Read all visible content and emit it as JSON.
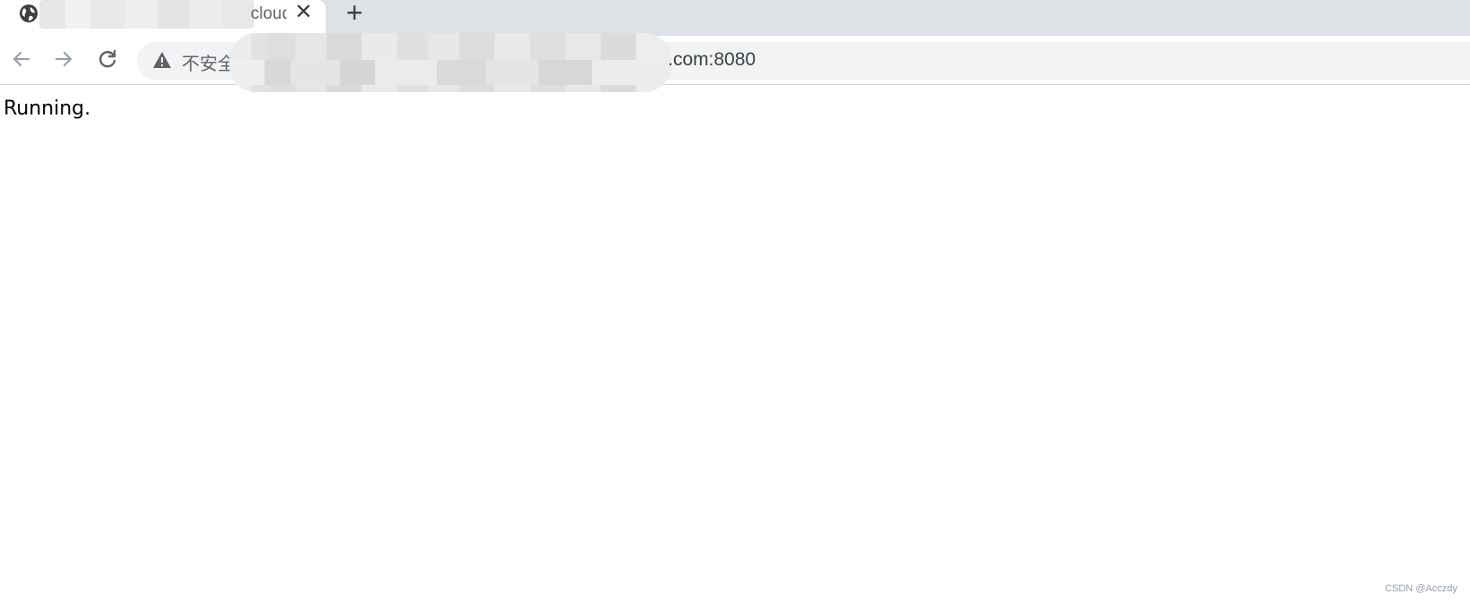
{
  "tab": {
    "title": "cloud",
    "favicon": "globe-icon",
    "close_glyph": "✕"
  },
  "newtab": {
    "glyph": "+"
  },
  "toolbar": {
    "back_icon": "arrow-left-icon",
    "forward_icon": "arrow-right-icon",
    "reload_icon": "reload-icon"
  },
  "omnibox": {
    "security_icon": "warning-icon",
    "security_label": "不安全",
    "url_visible": ".com:8080"
  },
  "page": {
    "content": "Running."
  },
  "watermark": "CSDN @Acczdy",
  "colors": {
    "tabstrip": "#dee1e6",
    "omnibox": "#f1f3f4",
    "icon": "#5f6368",
    "text": "#3c4043"
  }
}
